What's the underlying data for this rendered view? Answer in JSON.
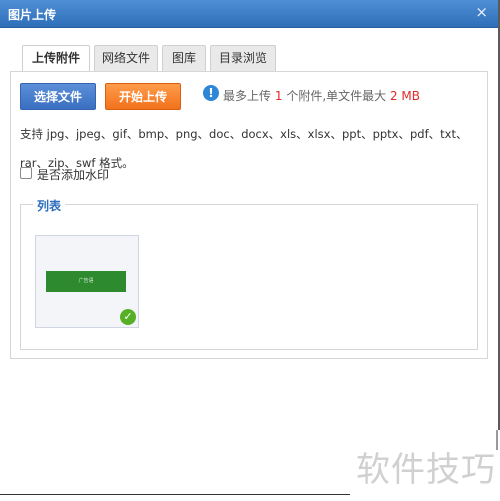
{
  "window": {
    "title": "图片上传",
    "close_label": "×"
  },
  "tabs": [
    {
      "label": "上传附件",
      "active": true
    },
    {
      "label": "网络文件",
      "active": false
    },
    {
      "label": "图库",
      "active": false
    },
    {
      "label": "目录浏览",
      "active": false
    }
  ],
  "upload": {
    "select_label": "选择文件",
    "start_label": "开始上传",
    "info_icon": "!",
    "info_prefix": "最多上传",
    "max_count": "1",
    "info_middle": "个附件,单文件最大",
    "max_size": "2 MB",
    "support_text": "支持 jpg、jpeg、gif、bmp、png、doc、docx、xls、xlsx、ppt、pptx、pdf、txt、rar、zip、swf 格式。",
    "watermark_label": "是否添加水印",
    "watermark_checked": false
  },
  "list": {
    "legend": "列表",
    "items": [
      {
        "thumb_text": "广告语",
        "uploaded": true
      }
    ]
  },
  "page_watermark": "软件技巧",
  "colors": {
    "title_bar": "#2f6fb9",
    "select_button": "#3a6fc1",
    "start_button": "#f2711c",
    "highlight": "#e12a2a",
    "success": "#55b026"
  }
}
